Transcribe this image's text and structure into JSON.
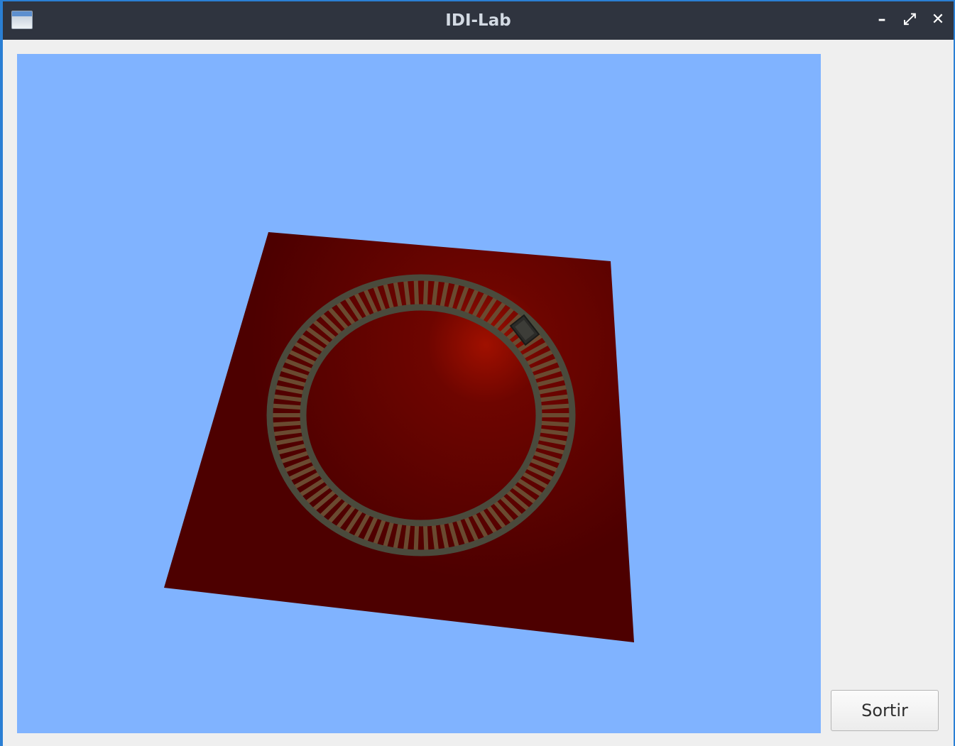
{
  "window": {
    "title": "IDI-Lab",
    "controls": {
      "minimize": "–",
      "maximize": "⤢",
      "close": "✕"
    }
  },
  "scene": {
    "background_color": "#80b3ff",
    "ground_color": "#5a0000",
    "track_color": "#4a4a3c",
    "sleeper_color": "#6a4a30",
    "sleeper_count": 90,
    "highlight_color": "#a01000"
  },
  "buttons": {
    "exit_label": "Sortir"
  }
}
